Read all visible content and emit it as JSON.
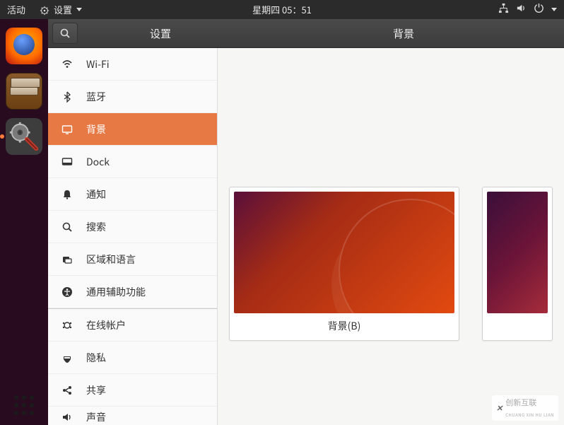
{
  "topbar": {
    "activities": "活动",
    "app_menu": "设置",
    "clock": "星期四 05：51"
  },
  "launcher": {
    "items": [
      "firefox-launcher",
      "files-launcher",
      "settings-launcher"
    ],
    "settings_running": true
  },
  "window": {
    "settings_title": "设置",
    "panel_title": "背景"
  },
  "sidebar": {
    "items": [
      {
        "icon": "wifi-icon",
        "label": "Wi-Fi"
      },
      {
        "icon": "bluetooth-icon",
        "label": "蓝牙"
      },
      {
        "icon": "background-icon",
        "label": "背景",
        "selected": true
      },
      {
        "icon": "dock-icon",
        "label": "Dock"
      },
      {
        "icon": "bell-icon",
        "label": "通知"
      },
      {
        "icon": "search-icon",
        "label": "搜索"
      },
      {
        "icon": "region-icon",
        "label": "区域和语言"
      },
      {
        "icon": "accessibility-icon",
        "label": "通用辅助功能"
      },
      {
        "icon": "online-accounts-icon",
        "label": "在线帐户",
        "sep_before": true
      },
      {
        "icon": "privacy-icon",
        "label": "隐私"
      },
      {
        "icon": "sharing-icon",
        "label": "共享"
      },
      {
        "icon": "sound-icon",
        "label": "声音"
      }
    ]
  },
  "content": {
    "thumb_bg_label": "背景(B)"
  },
  "watermark": {
    "cn": "创新互联",
    "py": "CHUANG XIN HU LIAN"
  }
}
